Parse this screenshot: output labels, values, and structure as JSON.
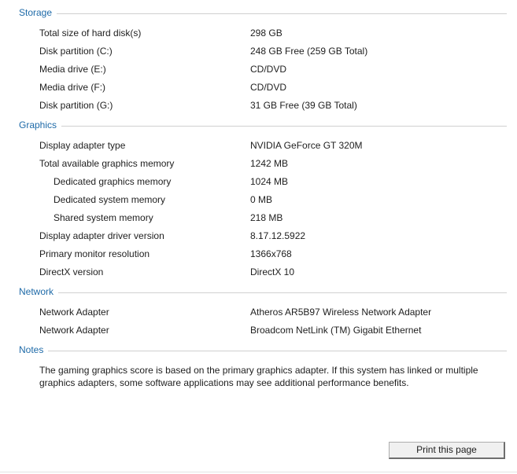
{
  "sections": {
    "storage": {
      "title": "Storage",
      "rows": [
        {
          "label": "Total size of hard disk(s)",
          "value": "298 GB"
        },
        {
          "label": "Disk partition (C:)",
          "value": "248 GB Free (259 GB Total)"
        },
        {
          "label": "Media drive (E:)",
          "value": "CD/DVD"
        },
        {
          "label": "Media drive (F:)",
          "value": "CD/DVD"
        },
        {
          "label": "Disk partition (G:)",
          "value": "31 GB Free (39 GB Total)"
        }
      ]
    },
    "graphics": {
      "title": "Graphics",
      "rows": [
        {
          "label": "Display adapter type",
          "value": "NVIDIA GeForce GT 320M"
        },
        {
          "label": "Total available graphics memory",
          "value": "1242 MB"
        },
        {
          "label": "Dedicated graphics memory",
          "value": "1024 MB"
        },
        {
          "label": "Dedicated system memory",
          "value": "0 MB"
        },
        {
          "label": "Shared system memory",
          "value": "218 MB"
        },
        {
          "label": "Display adapter driver version",
          "value": "8.17.12.5922"
        },
        {
          "label": "Primary monitor resolution",
          "value": "1366x768"
        },
        {
          "label": "DirectX version",
          "value": "DirectX 10"
        }
      ]
    },
    "network": {
      "title": "Network",
      "rows": [
        {
          "label": "Network Adapter",
          "value": "Atheros AR5B97 Wireless Network Adapter"
        },
        {
          "label": "Network Adapter",
          "value": "Broadcom NetLink (TM) Gigabit Ethernet"
        }
      ]
    },
    "notes": {
      "title": "Notes",
      "text": "The gaming graphics score is based on the primary graphics adapter. If this system has linked or multiple graphics adapters, some software applications may see additional performance benefits."
    }
  },
  "footer": {
    "print_label": "Print this page"
  },
  "colors": {
    "section_heading": "#1e6aa8",
    "rule": "#d0d0d0",
    "button_bg": "#f0f0f0"
  }
}
